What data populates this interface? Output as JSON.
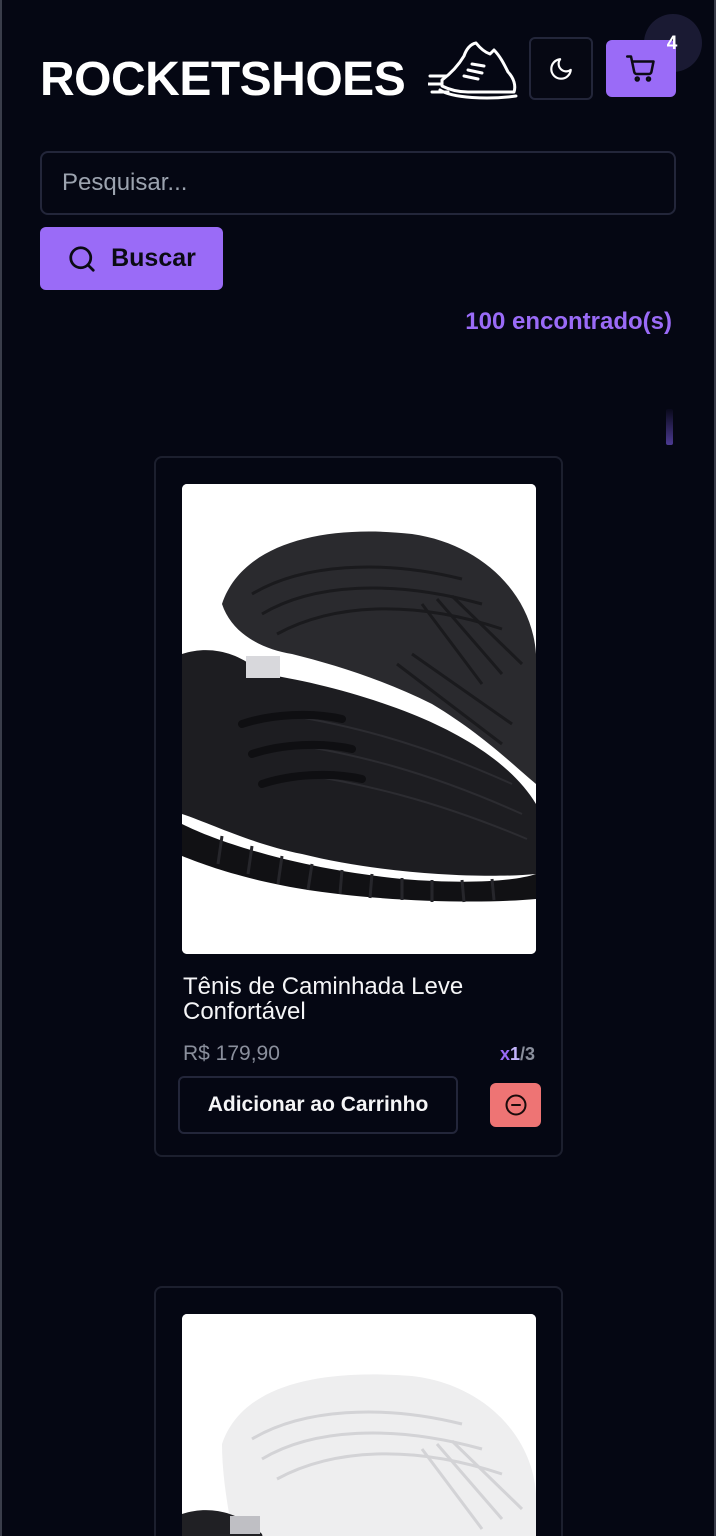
{
  "header": {
    "logo_text": "ROCKETSHOES",
    "logo_icon": "running-shoe-icon",
    "theme_toggle_icon": "moon-icon",
    "cart_icon": "shopping-cart-icon",
    "cart_count": "4"
  },
  "search": {
    "placeholder": "Pesquisar...",
    "value": "",
    "button_label": "Buscar",
    "button_icon": "search-icon"
  },
  "results": {
    "found_label": "100 encontrado(s)"
  },
  "products": [
    {
      "name": "Tênis de Caminhada Leve Confortável",
      "price": "R$ 179,90",
      "qty_prefix": "x",
      "qty_in_cart": "1",
      "qty_sep": "/",
      "qty_stock": "3",
      "add_label": "Adicionar ao Carrinho",
      "remove_icon": "minus-circle-icon"
    },
    {
      "name": "",
      "price": ""
    }
  ],
  "colors": {
    "background": "#050713",
    "accent": "#9a6bf7",
    "danger": "#ee7474",
    "border": "#23263a",
    "muted_text": "#8a8f9c"
  }
}
